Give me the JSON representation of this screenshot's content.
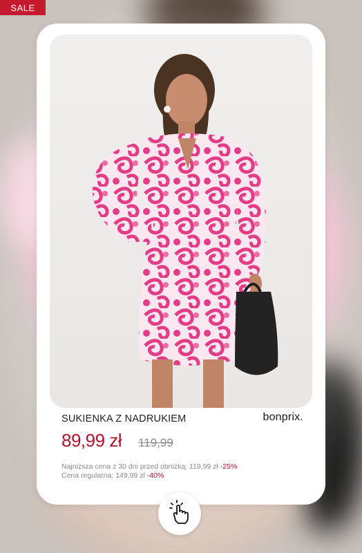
{
  "badge": {
    "sale_label": "SALE"
  },
  "product": {
    "name": "SUKIENKA Z NADRUKIEM",
    "brand": "bonprix.",
    "price_current": "89,99 zł",
    "price_old": "119,99",
    "lowest_price_text": "Najniższa cena z 30 dni przed obniżką: 119,99 zł",
    "lowest_price_discount": "-25%",
    "regular_price_text": "Cena regularna: 149,99 zł",
    "regular_price_discount": "-40%"
  },
  "colors": {
    "sale_red": "#c5192d",
    "price_red": "#b3122a",
    "dress_pink": "#e8478a"
  },
  "icons": {
    "tap": "hand-tap-icon"
  }
}
